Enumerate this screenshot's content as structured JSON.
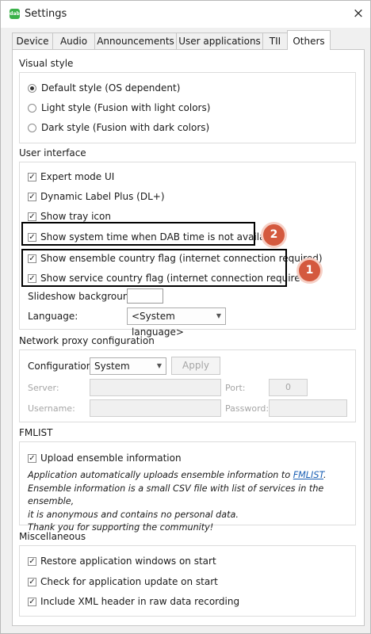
{
  "window": {
    "title": "Settings",
    "app_icon_text": "dab",
    "close_glyph": "×"
  },
  "tabs": [
    "Device",
    "Audio",
    "Announcements",
    "User applications",
    "TII",
    "Others"
  ],
  "active_tab": "Others",
  "visual_style": {
    "title": "Visual style",
    "options": [
      "Default style (OS dependent)",
      "Light style (Fusion with light colors)",
      "Dark style (Fusion with dark colors)"
    ],
    "selected": 0
  },
  "user_interface": {
    "title": "User interface",
    "checks": [
      {
        "label": "Expert mode UI",
        "checked": true
      },
      {
        "label": "Dynamic Label Plus (DL+)",
        "checked": true
      },
      {
        "label": "Show tray icon",
        "checked": true
      },
      {
        "label": "Show system time when DAB time is not available",
        "checked": true
      },
      {
        "label": "Show ensemble country flag (internet connection required)",
        "checked": true
      },
      {
        "label": "Show service country flag (internet connection required)",
        "checked": true
      }
    ],
    "slideshow_label": "Slideshow background:",
    "language_label": "Language:",
    "language_value": "<System language>"
  },
  "annotations": {
    "badge1": "1",
    "badge2": "2",
    "color": "#d4593e"
  },
  "proxy": {
    "title": "Network proxy configuration",
    "config_label": "Configuration:",
    "config_value": "System",
    "apply_label": "Apply",
    "server_label": "Server:",
    "port_label": "Port:",
    "port_value": "0",
    "username_label": "Username:",
    "password_label": "Password:"
  },
  "fmlist": {
    "title": "FMLIST",
    "upload_label": "Upload ensemble information",
    "upload_checked": true,
    "desc_before_link": "Application automatically uploads ensemble information to ",
    "link_text": "FMLIST",
    "desc_after_link": ".",
    "desc_line2": "Ensemble information is a small CSV file with list of services in the ensemble,",
    "desc_line3": "it is anonymous and contains no personal data.",
    "desc_line4": "Thank you for supporting the community!"
  },
  "misc": {
    "title": "Miscellaneous",
    "checks": [
      {
        "label": "Restore application windows on start",
        "checked": true
      },
      {
        "label": "Check for application update on start",
        "checked": true
      },
      {
        "label": "Include XML header in raw data recording",
        "checked": true
      }
    ]
  },
  "icons": {
    "check": "✓",
    "dropdown": "▼"
  }
}
